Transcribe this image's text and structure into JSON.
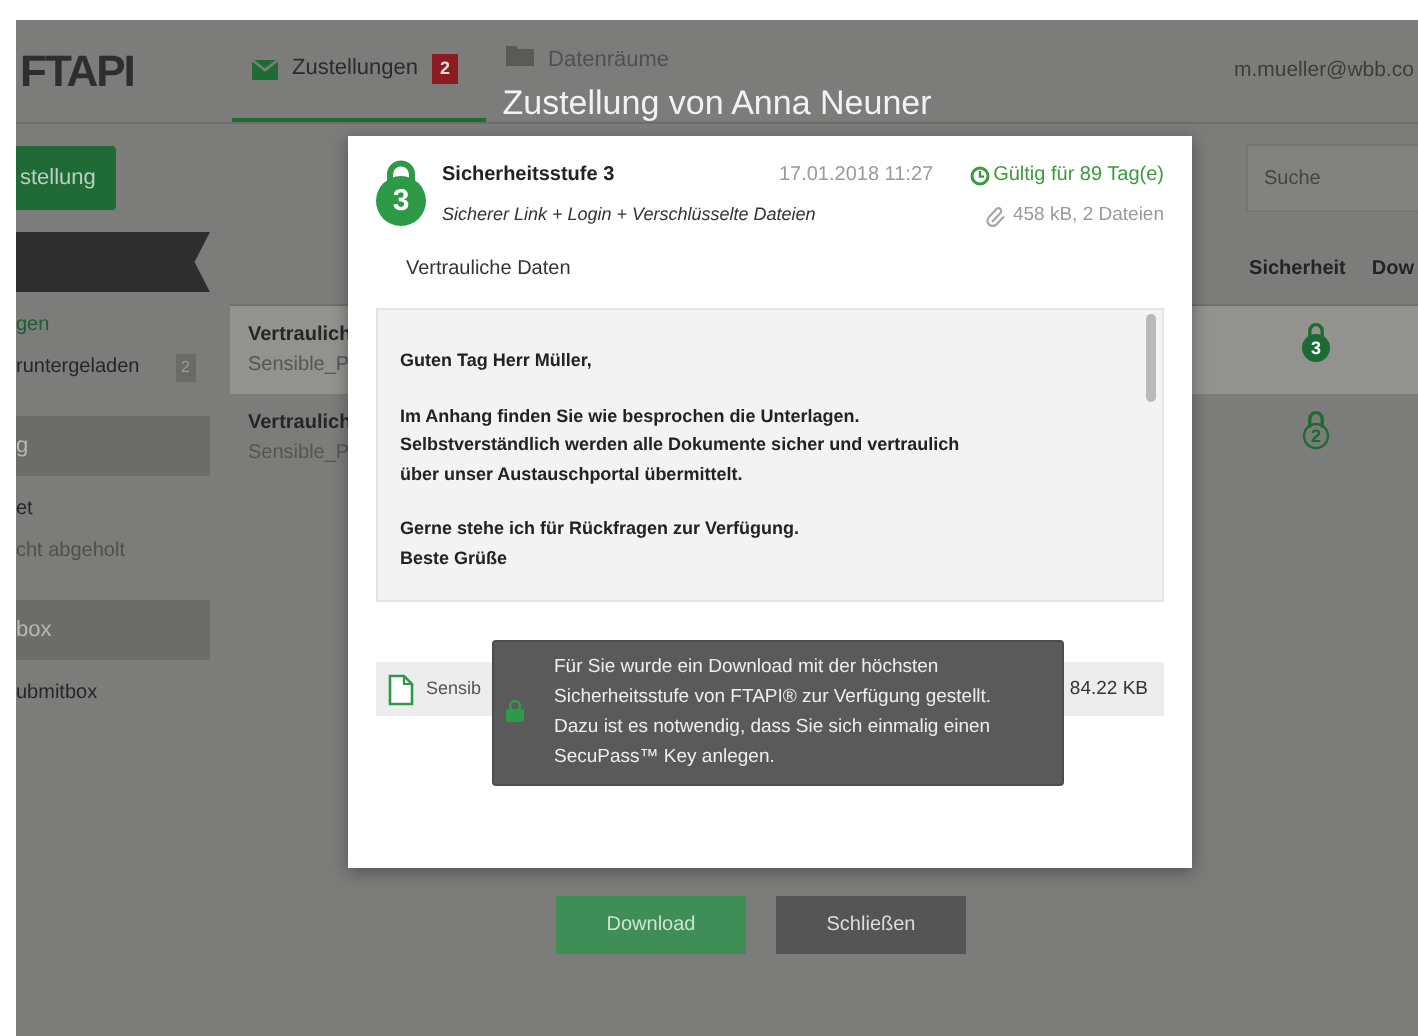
{
  "app_bar": {
    "logo": "FTAPI",
    "tabs": [
      {
        "label": "Zustellungen",
        "badge": "2",
        "selected": true
      },
      {
        "label": "Datenräume",
        "selected": false
      }
    ],
    "user": "m.mueller@wbb.co"
  },
  "toolbar": {
    "new_button": "stellung",
    "search": {
      "placeholder": "Suche"
    }
  },
  "sidebar": {
    "sections": [
      {
        "kind": "dark",
        "items": [
          {
            "label": "gen",
            "selected": true,
            "muted": false
          },
          {
            "label": "runtergeladen",
            "badge": "2",
            "selected": false,
            "muted": false
          }
        ]
      },
      {
        "kind": "gray",
        "header": "g",
        "items": [
          {
            "label": "et",
            "selected": false,
            "muted": false
          },
          {
            "label": "cht abgeholt",
            "selected": false,
            "muted": true
          }
        ]
      },
      {
        "kind": "gray",
        "header": "box",
        "items": [
          {
            "label": "ubmitbox",
            "selected": false,
            "muted": false
          }
        ]
      }
    ]
  },
  "table": {
    "columns": [
      "Sicherheit",
      "Dow"
    ],
    "rows": [
      {
        "title": "Vertraulich",
        "subtitle": "Sensible_P",
        "level": "3",
        "kind": "filled",
        "selected": true
      },
      {
        "title": "Vertraulich",
        "subtitle": "Sensible_P",
        "level": "2",
        "kind": "outline",
        "selected": false
      }
    ]
  },
  "modal": {
    "title": "Zustellung von Anna Neuner",
    "level": "3",
    "heading": "Sicherheitsstufe 3",
    "date": "17.01.2018 11:27",
    "validity": "Gültig für 89 Tag(e)",
    "subtitle": "Sicherer Link + Login + Verschlüsselte Dateien",
    "size": "458 kB, 2 Dateien",
    "subject": "Vertrauliche Daten",
    "message": [
      [
        "Guten Tag Herr Müller,"
      ],
      [
        "Im Anhang finden Sie wie besprochen die Unterlagen.",
        "Selbstverständlich werden alle Dokumente sicher und vertraulich",
        "über unser Austauschportal übermittelt."
      ],
      [
        "Gerne stehe ich für Rückfragen zur Verfügung.",
        "Beste Grüße"
      ]
    ],
    "attachment": {
      "name": "Sensib",
      "size": "84.22 KB"
    },
    "tooltip": "Für Sie wurde ein Download mit der höchsten Sicherheitsstufe von FTAPI® zur Verfügung gestellt. Dazu ist es notwendig, dass Sie sich einmalig einen SecuPass™ Key anlegen.",
    "buttons": [
      {
        "label": "Download",
        "kind": "primary"
      },
      {
        "label": "Schließen",
        "kind": "secondary"
      }
    ]
  }
}
